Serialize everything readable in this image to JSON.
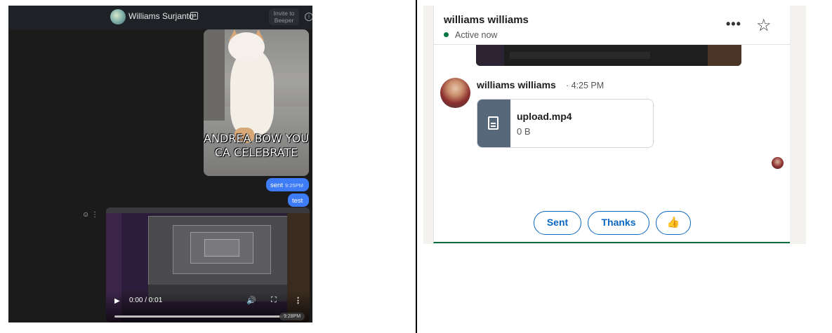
{
  "beeper": {
    "contact_name": "Williams Surjanto",
    "linkedin_badge": "in",
    "invite_label": "Invite to Beeper",
    "info_icon": "i",
    "gif_caption": "ANDREA BOW YOU CA CELEBRATE",
    "messages": [
      {
        "text": "sent",
        "time": "9:25PM"
      },
      {
        "text": "test"
      }
    ],
    "message_tools": "☺ ⋮",
    "video": {
      "play": "▶",
      "time": "0:00 / 0:01",
      "volume": "🔊",
      "fullscreen": "⛶",
      "more": "⋮",
      "timestamp": "9:28PM"
    }
  },
  "linkedin": {
    "contact_name": "williams williams",
    "status": "Active now",
    "more_icon": "•••",
    "star_icon": "☆",
    "message": {
      "sender": "williams williams",
      "time": "· 4:25 PM",
      "file_name": "upload.mp4",
      "file_size": "0 B"
    },
    "quick_replies": [
      "Sent",
      "Thanks",
      "👍"
    ],
    "colors": {
      "accent": "#0a66c2",
      "active": "#057642",
      "beeper_bubble": "#3e7bf6"
    }
  }
}
